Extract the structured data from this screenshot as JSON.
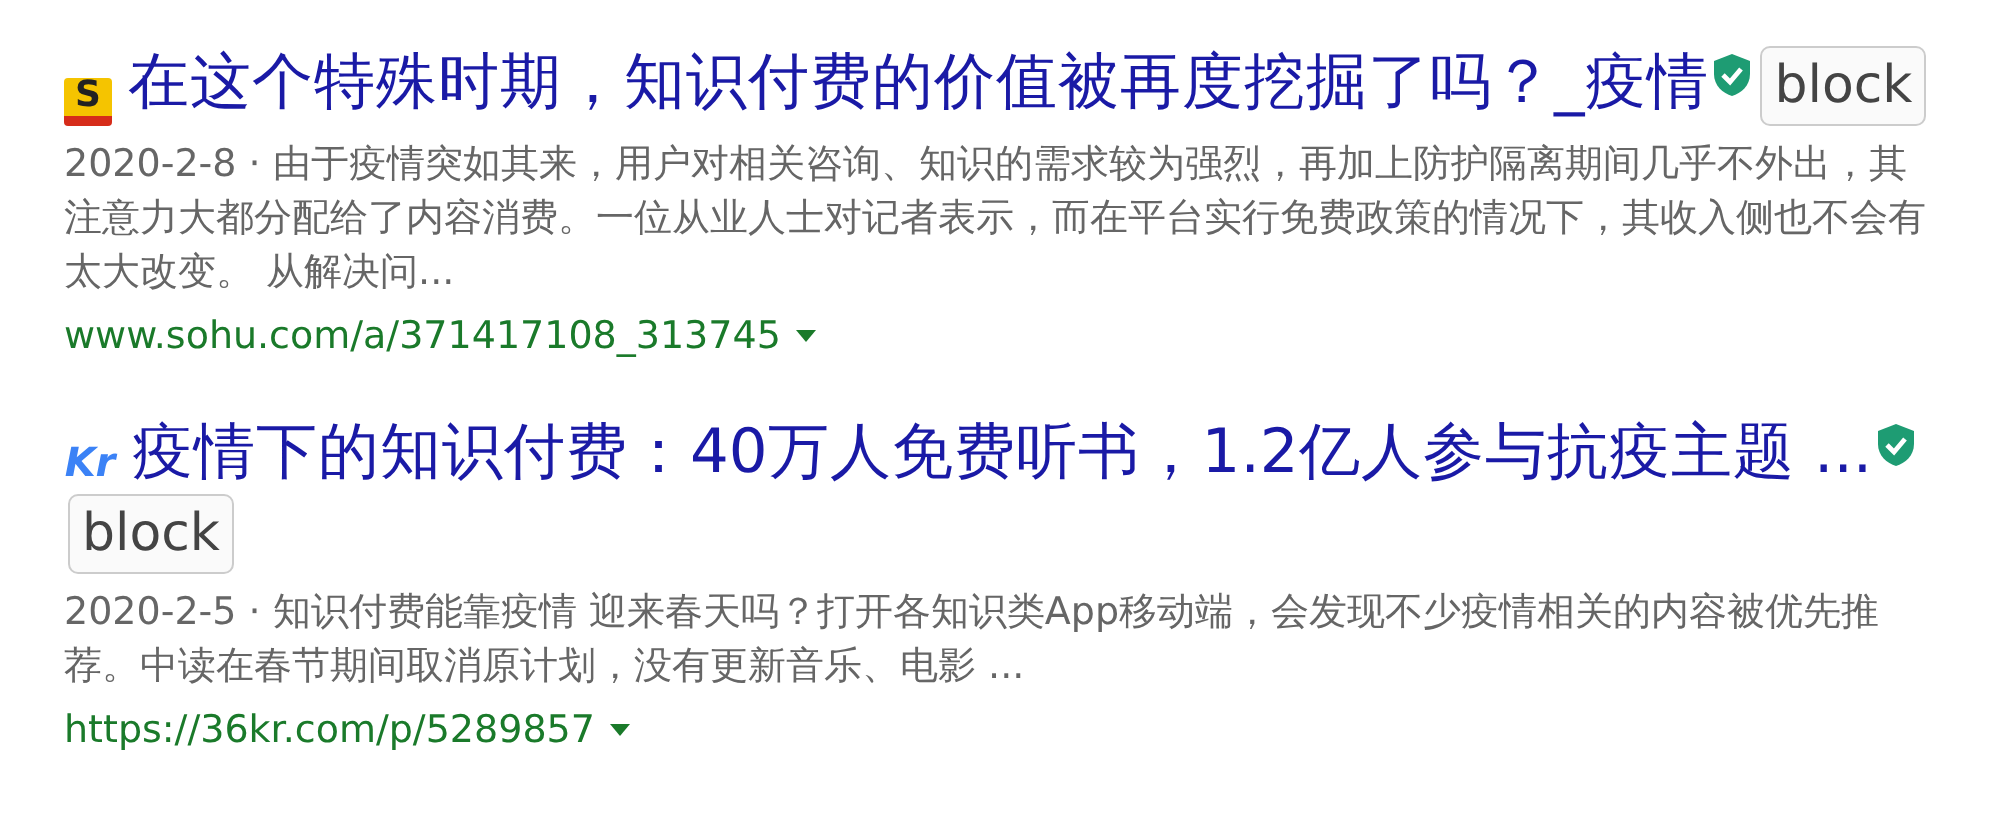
{
  "results": [
    {
      "favicon": "S",
      "kind": "sohu",
      "title": "在这个特殊时期，知识付费的价值被再度挖掘了吗？_疫情",
      "verified": true,
      "block_label": "block",
      "date": "2020-2-8",
      "separator": "·",
      "snippet": "由于疫情突如其来，用户对相关咨询、知识的需求较为强烈，再加上防护隔离期间几乎不外出，其注意力大都分配给了内容消费。一位从业人士对记者表示，而在平台实行免费政策的情况下，其收入侧也不会有太大改变。 从解决问...",
      "url": "www.sohu.com/a/371417108_313745"
    },
    {
      "favicon": "Kr",
      "kind": "kr",
      "title": "疫情下的知识付费：40万人免费听书，1.2亿人参与抗疫主题 ...",
      "verified": true,
      "block_label": "block",
      "date": "2020-2-5",
      "separator": "·",
      "snippet": "知识付费能靠疫情 迎来春天吗？打开各知识类App移动端，会发现不少疫情相关的内容被优先推荐。中读在春节期间取消原计划，没有更新音乐、电影 ...",
      "url": "https://36kr.com/p/5289857"
    }
  ]
}
